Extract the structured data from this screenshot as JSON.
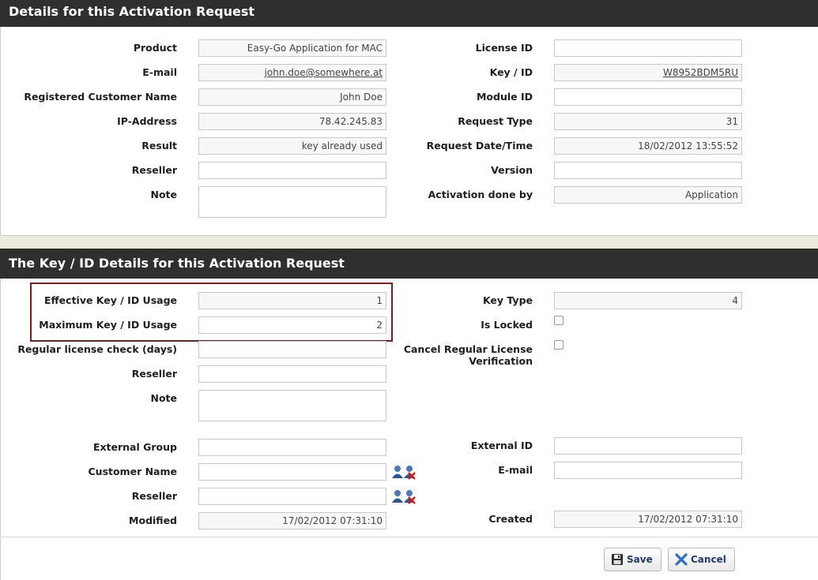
{
  "section1": {
    "title": "Details for this Activation Request",
    "left": [
      {
        "label": "Product",
        "value": "Easy-Go Application for MAC"
      },
      {
        "label": "E-mail",
        "value": "john.doe@somewhere.at"
      },
      {
        "label": "Registered Customer Name",
        "value": "John Doe"
      },
      {
        "label": "IP-Address",
        "value": "78.42.245.83"
      },
      {
        "label": "Result",
        "value": "key already used"
      },
      {
        "label": "Reseller",
        "value": ""
      },
      {
        "label": "Note",
        "value": ""
      }
    ],
    "right": [
      {
        "label": "License ID",
        "value": ""
      },
      {
        "label": "Key / ID",
        "value": "W8952BDM5RU"
      },
      {
        "label": "Module ID",
        "value": ""
      },
      {
        "label": "Request Type",
        "value": "31"
      },
      {
        "label": "Request Date/Time",
        "value": "18/02/2012 13:55:52"
      },
      {
        "label": "Version",
        "value": ""
      },
      {
        "label": "Activation done by",
        "value": "Application"
      }
    ]
  },
  "section2": {
    "title": "The Key / ID Details for this Activation Request",
    "left": [
      {
        "label": "Effective Key / ID Usage",
        "value": "1"
      },
      {
        "label": "Maximum Key / ID Usage",
        "value": "2"
      },
      {
        "label": "Regular license check (days)",
        "value": ""
      },
      {
        "label": "Reseller",
        "value": ""
      },
      {
        "label": "Note",
        "value": ""
      },
      {
        "label": "External Group",
        "value": ""
      },
      {
        "label": "Customer Name",
        "value": ""
      },
      {
        "label": "Reseller",
        "value": ""
      },
      {
        "label": "Modified",
        "value": "17/02/2012 07:31:10"
      }
    ],
    "right": [
      {
        "label": "Key Type",
        "value": "4"
      },
      {
        "label": "Is Locked",
        "checked": false
      },
      {
        "label": "Cancel Regular License Verification",
        "checked": false
      },
      {
        "label": "External ID",
        "value": ""
      },
      {
        "label": "E-mail",
        "value": ""
      },
      {
        "label": "Created",
        "value": "17/02/2012 07:31:10"
      }
    ]
  },
  "buttons": {
    "save_label": "Save",
    "cancel_label": "Cancel"
  },
  "icons": {
    "user_select": "user-select-icon",
    "user_remove": "user-remove-icon",
    "save": "floppy-disk-icon",
    "cancel": "x-cancel-icon"
  },
  "colors": {
    "header_bg": "#2f2f2f",
    "highlight_border": "#7a1f1f",
    "button_text": "#1d3c6b",
    "cancel_x": "#2a6fc9"
  }
}
